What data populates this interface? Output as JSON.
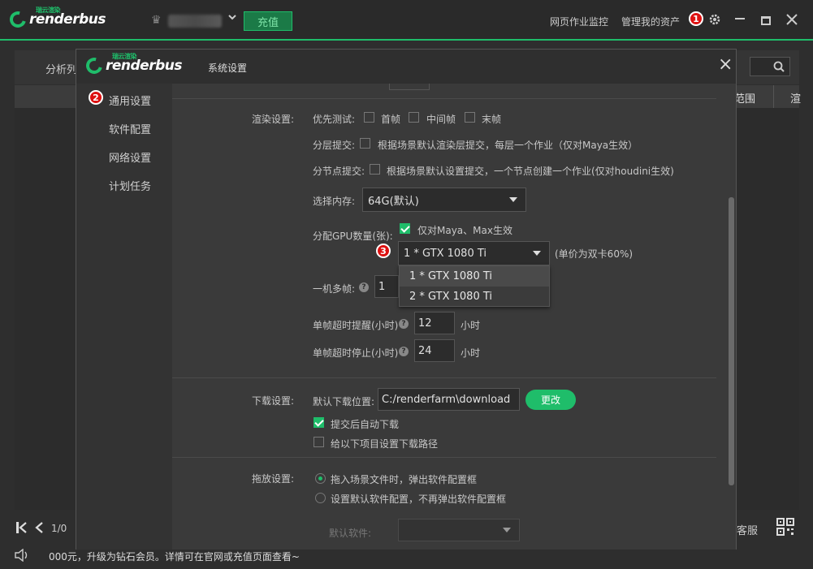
{
  "topbar": {
    "logo_text": "renderbus",
    "logo_cn": "瑞云渲染",
    "recharge_label": "充值",
    "link_monitor": "网页作业监控",
    "link_assets": "管理我的资产",
    "badge1": "1"
  },
  "bg": {
    "tab_analysis": "分析列",
    "col_range": "范围",
    "col_render": "渲",
    "page_indicator": "1/0",
    "customer_service": "客服",
    "status_text": "000元，升级为钻石会员。详情可在官网或充值页面查看~"
  },
  "dialog": {
    "logo_text": "renderbus",
    "logo_cn": "瑞云渲染",
    "title": "系统设置",
    "close": "×",
    "sidebar": [
      {
        "label": "通用设置",
        "badge": "2"
      },
      {
        "label": "软件配置"
      },
      {
        "label": "网络设置"
      },
      {
        "label": "计划任务"
      }
    ],
    "render": {
      "section": "渲染设置:",
      "priority_label": "优先测试:",
      "first_frame": "首帧",
      "middle_frame": "中间帧",
      "last_frame": "末帧",
      "layer_label": "分层提交:",
      "layer_text": "根据场景默认渲染层提交，每层一个作业（仅对Maya生效）",
      "node_label": "分节点提交:",
      "node_text": "根据场景默认设置提交，一个节点创建一个作业(仅对houdini生效)",
      "memory_label": "选择内存:",
      "memory_value": "64G(默认)",
      "gpu_label": "分配GPU数量(张):",
      "gpu_only": "仅对Maya、Max生效",
      "gpu_value": "1 * GTX 1080 Ti",
      "gpu_note": "(单价为双卡60%)",
      "gpu_options": [
        "1 * GTX 1080 Ti",
        "2 * GTX 1080 Ti"
      ],
      "badge3": "3",
      "multi_label": "一机多帧:",
      "multi_value": "1",
      "timeout_warn_label": "单帧超时提醒(小时)",
      "timeout_warn_value": "12",
      "timeout_stop_label": "单帧超时停止(小时)",
      "timeout_stop_value": "24",
      "hour": "小时"
    },
    "download": {
      "section": "下载设置:",
      "path_label": "默认下载位置:",
      "path_value": "C:/renderfarm\\download",
      "change_btn": "更改",
      "auto_download": "提交后自动下载",
      "set_path": "给以下项目设置下载路径"
    },
    "drag": {
      "section": "拖放设置:",
      "opt1": "拖入场景文件时，弹出软件配置框",
      "opt2": "设置默认软件配置，不再弹出软件配置框",
      "default_software_label": "默认软件:"
    }
  },
  "colors": {
    "accent": "#1fbd6a",
    "badge": "#dd1111"
  }
}
